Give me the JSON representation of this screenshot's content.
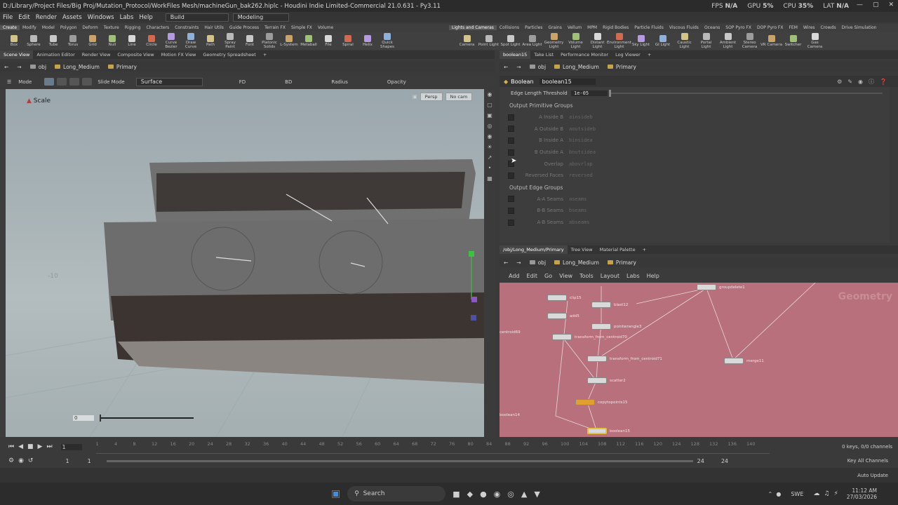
{
  "window_title": "D:/Library/Project Files/Big Proj/Mutation_Protocol/WorkFiles Mesh/machineGun_bak262.hiplc - Houdini Indie Limited-Commercial 21.0.631 - Py3.11",
  "stats": {
    "fps_label": "FPS",
    "fps": "N/A",
    "gpu_label": "GPU",
    "gpu": "5%",
    "cpu_label": "CPU",
    "cpu": "35%",
    "lat_label": "LAT",
    "lat": "N/A"
  },
  "menu": [
    "File",
    "Edit",
    "Render",
    "Assets",
    "Windows",
    "Labs",
    "Help"
  ],
  "desktops": [
    "Build",
    "Modeling"
  ],
  "shelf_tabs_left": [
    "Create",
    "Modify",
    "Model",
    "Polygon",
    "Deform",
    "Texture",
    "Rigging",
    "Characters",
    "Constraints",
    "Hair Utils",
    "Guide Process",
    "Terrain FX",
    "Simple FX",
    "Volume"
  ],
  "shelf_tabs_right": [
    "Lights and Cameras",
    "Collisions",
    "Particles",
    "Grains",
    "Vellum",
    "MPM",
    "Rigid Bodies",
    "Particle Fluids",
    "Viscous Fluids",
    "Oceans",
    "SOP Pyro FX",
    "DOP Pyro FX",
    "FEM",
    "Wires",
    "Crowds",
    "Drive Simulation"
  ],
  "tools_left": [
    "Box",
    "Sphere",
    "Tube",
    "Torus",
    "Grid",
    "Null",
    "Line",
    "Circle",
    "Curve Bezier",
    "Draw Curve",
    "Path",
    "Spray Paint",
    "Font",
    "Platonic Solids",
    "L-System",
    "Metaball",
    "File",
    "Spiral",
    "Helix",
    "Quick Shapes"
  ],
  "tools_right": [
    "Camera",
    "Point Light",
    "Spot Light",
    "Area Light",
    "Geometry Light",
    "Volume Light",
    "Distant Light",
    "Environment Light",
    "Sky Light",
    "GI Light",
    "Caustic Light",
    "Portal Light",
    "Ambient Light",
    "Stereo Camera",
    "VR Camera",
    "Switcher",
    "Gas Camera"
  ],
  "left_panel_tabs": [
    "Scene View",
    "Animation Editor",
    "Render View",
    "Composite View",
    "Motion FX View",
    "Geometry Spreadsheet"
  ],
  "right_panel_tabs": [
    "boolean15",
    "Take List",
    "Performance Monitor",
    "Log Viewer"
  ],
  "path": {
    "obj": "obj",
    "object": "Long_Medium",
    "primary": "Primary"
  },
  "viewport": {
    "mode_label": "Mode",
    "slide_mode": "Slide Mode",
    "surface": "Surface",
    "fd": "FD",
    "bd": "BD",
    "radius": "Radius",
    "opacity": "Opacity",
    "tool_name": "Scale",
    "persp": "Persp",
    "cam": "No cam",
    "frame_value": "0",
    "axis_label": "-10"
  },
  "params": {
    "node_type": "Boolean",
    "node_name": "boolean15",
    "edge_length_label": "Edge Length Threshold",
    "edge_length_value": "1e-05",
    "primitive_groups_header": "Output Primitive Groups",
    "primitive_groups": [
      {
        "label": "A Inside B",
        "value": "ainsideb"
      },
      {
        "label": "A Outside B",
        "value": "aoutsideb"
      },
      {
        "label": "B Inside A",
        "value": "binsidea"
      },
      {
        "label": "B Outside A",
        "value": "boutsidea"
      },
      {
        "label": "Overlap",
        "value": "abovrlap"
      },
      {
        "label": "Reversed Faces",
        "value": "reversed"
      }
    ],
    "edge_groups_header": "Output Edge Groups",
    "edge_groups": [
      {
        "label": "A-A Seams",
        "value": "aseams"
      },
      {
        "label": "B-B Seams",
        "value": "bseams"
      },
      {
        "label": "A-B Seams",
        "value": "abseams"
      }
    ]
  },
  "network_tabs": [
    "/obj/Long_Medium/Primary",
    "Tree View",
    "Material Palette"
  ],
  "network_menu": [
    "Add",
    "Edit",
    "Go",
    "View",
    "Tools",
    "Layout",
    "Labs",
    "Help"
  ],
  "network_watermark": "Geometry",
  "nodes": [
    "clip15",
    "blast12",
    "add5",
    "pointwrangle3",
    "transform_from_centroid70",
    "transform_from_centroid71",
    "scatter2",
    "copytopoints15",
    "boolean15",
    "merge11",
    "groupdelete1",
    "centroid69",
    "boolean14"
  ],
  "timeline": {
    "frames": [
      "1",
      "4",
      "8",
      "12",
      "16",
      "20",
      "24",
      "28",
      "32",
      "36",
      "40",
      "44",
      "48",
      "52",
      "56",
      "60",
      "64",
      "68",
      "72",
      "76",
      "80",
      "84",
      "88",
      "92",
      "96",
      "100",
      "104",
      "108",
      "112",
      "116",
      "120",
      "124",
      "128",
      "132",
      "136",
      "140"
    ],
    "start": "1",
    "end": "24",
    "current": "1",
    "range_start": "1",
    "range_end": "24",
    "keys_info": "0 keys, 0/0 channels",
    "key_all": "Key All Channels",
    "auto_update": "Auto Update"
  },
  "taskbar": {
    "search": "Search",
    "lang": "SWE",
    "time": "11:12 AM",
    "date": "27/03/2026"
  }
}
